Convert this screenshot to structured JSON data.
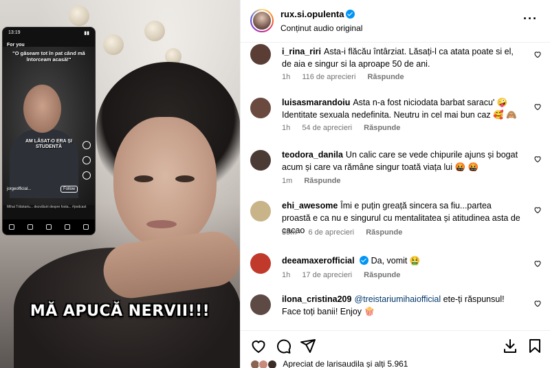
{
  "media": {
    "caption": "MĂ APUCĂ NERVII!!!",
    "phone": {
      "time": "13:19",
      "feed_label": "For you",
      "quote": "\"O găseam tot în pat când mă întorceam acasă!\"",
      "subtitle": "AM LĂSAT-O ERA ȘI STUDENTĂ",
      "user": "jorgeofficial...",
      "follow": "Follow",
      "desc": "Mihai Trăistariu... dezvăluiri despre fosta... #podcast"
    }
  },
  "post": {
    "username": "rux.si.opulenta",
    "audio": "Conținut audio original"
  },
  "comments": [
    {
      "username": "i_rina_riri",
      "text": "Asta-i flăcău întârziat. Lăsați-l ca atata poate si el, de aia e singur si la aproape 50 de ani.",
      "time": "1h",
      "likes": "116 de aprecieri",
      "reply": "Răspunde",
      "avatar_color": "#5a3d34"
    },
    {
      "username": "luisasmarandoiu",
      "text": "Asta n-a fost niciodata barbat saracu' 🤪 Identitate sexuala nedefinita. Neutru in cel mai bun caz 🥰 🙈",
      "time": "1h",
      "likes": "54 de aprecieri",
      "reply": "Răspunde",
      "avatar_color": "#6a4a3e"
    },
    {
      "username": "teodora_danila",
      "text": "Un calic care se vede chipurile ajuns și bogat acum și care va rămâne singur toată viața lui 🤬 🤬",
      "time": "1m",
      "likes": "",
      "reply": "Răspunde",
      "avatar_color": "#4a3b35"
    },
    {
      "username": "ehi_awesome",
      "text": "Îmi e puțin greață sincera sa fiu...partea proastă e ca nu e singurul cu mentalitatea și atitudinea asta de cacao",
      "time": "35m",
      "likes": "6 de aprecieri",
      "reply": "Răspunde",
      "avatar_color": "#c9b48a"
    },
    {
      "username": "deeamaxerofficial",
      "text": "Da, vomit 🤮",
      "time": "1h",
      "likes": "17 de aprecieri",
      "reply": "Răspunde",
      "avatar_color": "#c0392b"
    },
    {
      "username": "ilona_cristina209",
      "mention": "@treistariumihaiofficial",
      "text": "ete-ți răspunsul! Face toți banii! Enjoy 🍿",
      "time": "",
      "likes": "",
      "reply": "",
      "avatar_color": "#5d4a45"
    }
  ],
  "likes_summary": "Apreciat de larisaudila și alți 5.961",
  "icons": [
    "heart-icon",
    "comment-icon",
    "share-icon",
    "download-icon",
    "save-icon",
    "more-icon"
  ]
}
